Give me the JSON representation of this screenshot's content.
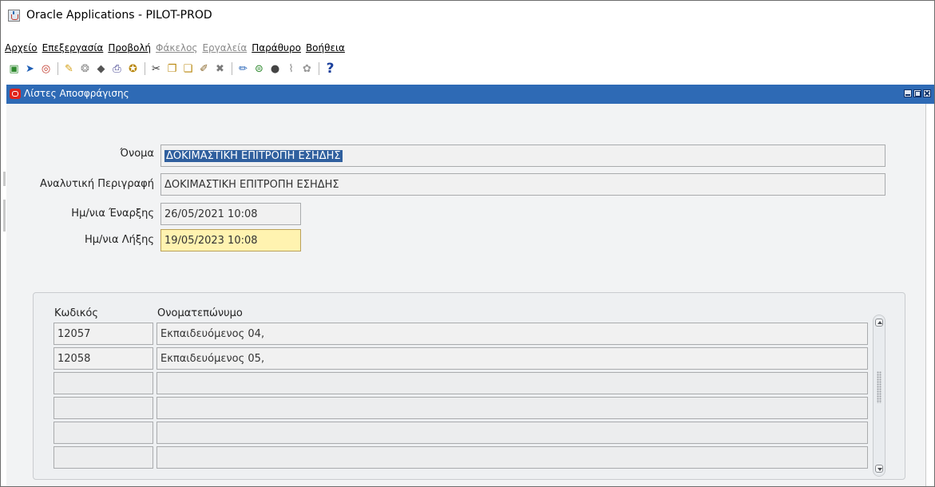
{
  "window": {
    "title": "Oracle Applications - PILOT-PROD"
  },
  "menu": [
    {
      "label": "Αρχείο",
      "disabled": false
    },
    {
      "label": "Επεξεργασία",
      "disabled": false
    },
    {
      "label": "Προβολή",
      "disabled": false
    },
    {
      "label": "Φάκελος",
      "disabled": true
    },
    {
      "label": "Εργαλεία",
      "disabled": true
    },
    {
      "label": "Παράθυρο",
      "disabled": false
    },
    {
      "label": "Βοήθεια",
      "disabled": false
    }
  ],
  "toolbar": {
    "icons": [
      "new-record-icon",
      "navigate-icon",
      "zoom-icon",
      "save-icon",
      "next-step-icon",
      "switch-responsibility-icon",
      "print-icon",
      "close-form-icon",
      "cut-icon",
      "copy-icon",
      "paste-icon",
      "clear-record-icon",
      "delete-record-icon",
      "edit-field-icon",
      "zoom-drilldown-icon",
      "translations-icon",
      "attachments-icon",
      "folder-tools-icon"
    ],
    "help_label": "?"
  },
  "form": {
    "title": "Λίστες Αποσφράγισης",
    "name_label": "Όνομα",
    "name_value": "ΔΟΚΙΜΑΣΤΙΚΗ ΕΠΙΤΡΟΠΗ ΕΣΗΔΗΣ",
    "description_label": "Αναλυτική Περιγραφή",
    "description_value": "ΔΟΚΙΜΑΣΤΙΚΗ ΕΠΙΤΡΟΠΗ ΕΣΗΔΗΣ",
    "start_date_label": "Ημ/νια Έναρξης",
    "start_date_value": "26/05/2021 10:08",
    "end_date_label": "Ημ/νια Λήξης",
    "end_date_value": "19/05/2023 10:08"
  },
  "members": {
    "columns": {
      "code": "Κωδικός",
      "name": "Ονοματεπώνυμο"
    },
    "rows": [
      {
        "code": "12057",
        "name": "Εκπαιδευόμενος 04,"
      },
      {
        "code": "12058",
        "name": "Εκπαιδευόμενος 05,"
      },
      {
        "code": "",
        "name": ""
      },
      {
        "code": "",
        "name": ""
      },
      {
        "code": "",
        "name": ""
      },
      {
        "code": "",
        "name": ""
      }
    ]
  },
  "colors": {
    "window_title_bar": "#2e6ab5",
    "active_field": "#fff3b0",
    "selection": "#2f5f9e",
    "form_background": "#f2f3f4"
  }
}
